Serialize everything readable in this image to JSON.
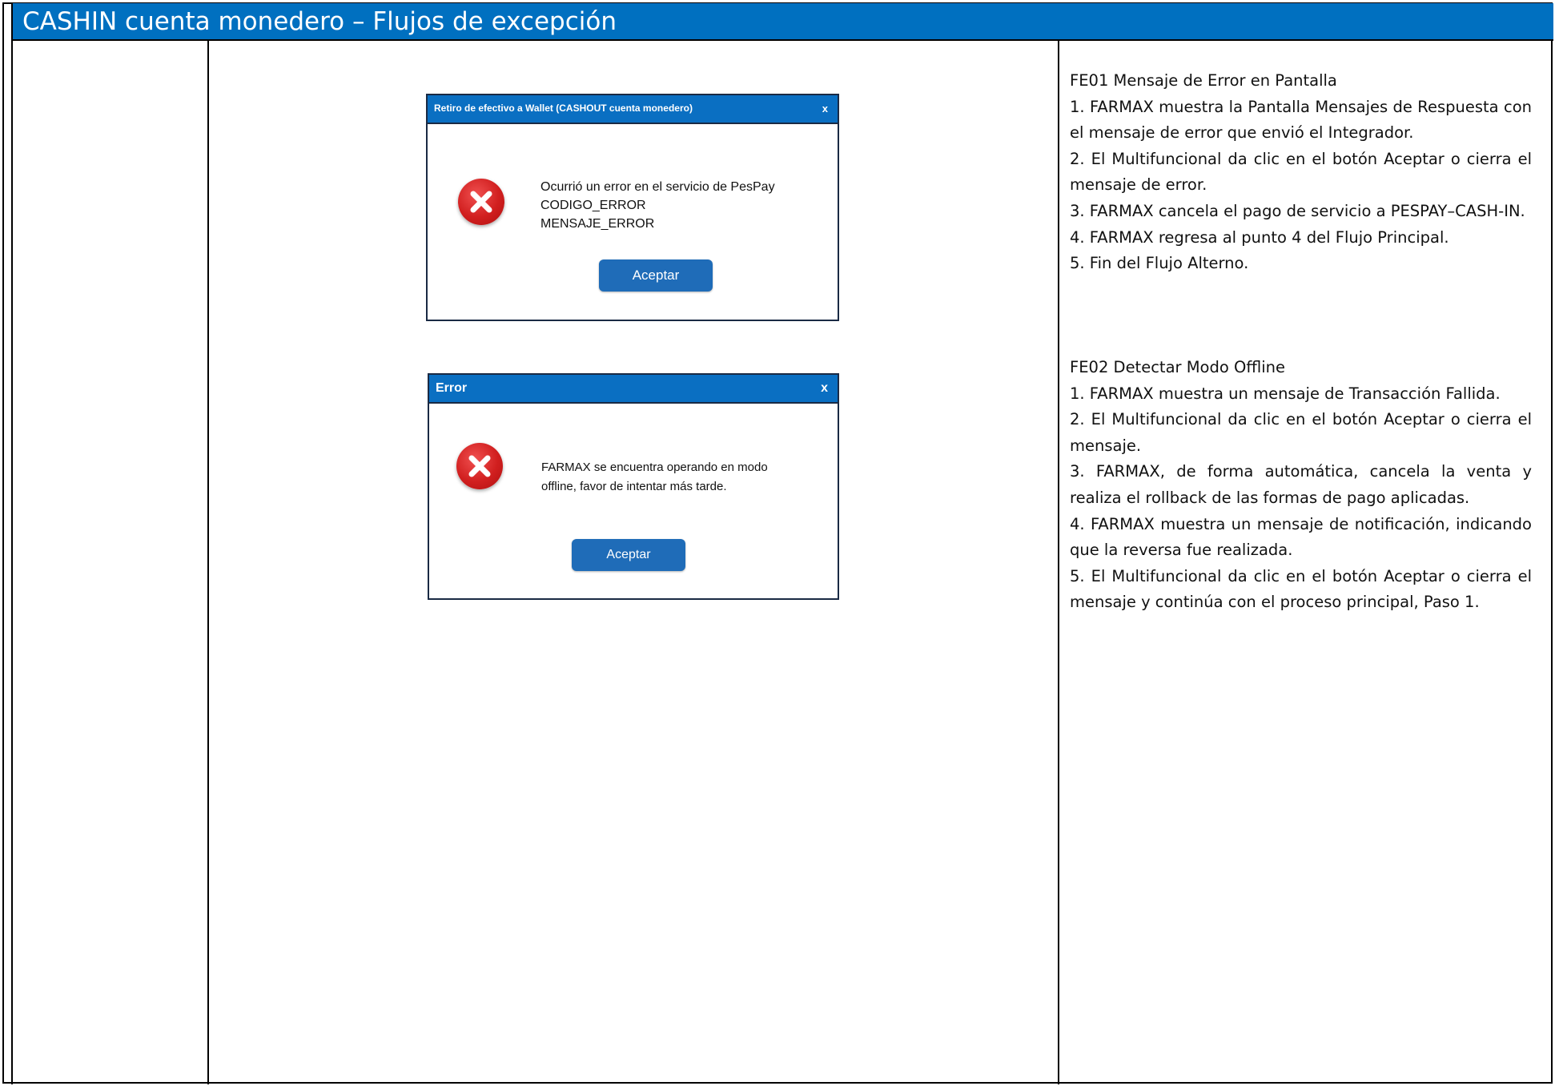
{
  "header": {
    "title": "CASHIN cuenta monedero – Flujos de excepción"
  },
  "dialogs": [
    {
      "title": "Retiro de efectivo a Wallet (CASHOUT cuenta monedero)",
      "close": "x",
      "message_lines": [
        "Ocurrió un error en el servicio de PesPay",
        "CODIGO_ERROR",
        "MENSAJE_ERROR"
      ],
      "button": "Aceptar",
      "icon": "error-x-icon",
      "titlebar_color": "#0a6fc2",
      "button_color": "#1f6cb8"
    },
    {
      "title": "Error",
      "close": "x",
      "message_lines": [
        "FARMAX se encuentra operando en modo",
        "offline, favor de intentar más tarde."
      ],
      "button": "Aceptar",
      "icon": "error-x-icon",
      "titlebar_color": "#0a6fc2",
      "button_color": "#1f6cb8"
    }
  ],
  "flows": [
    {
      "heading": "FE01 Mensaje de Error en Pantalla",
      "steps": [
        "1. FARMAX muestra la Pantalla Mensajes de Respuesta con el mensaje de error que envió el Integrador.",
        "2. El Multifuncional da clic en el botón Aceptar o cierra el mensaje de error.",
        "3. FARMAX cancela el pago de servicio a PESPAY–CASH-IN.",
        "4. FARMAX regresa al punto 4 del Flujo Principal.",
        "5. Fin del Flujo Alterno."
      ]
    },
    {
      "heading": "FE02 Detectar Modo Offline",
      "steps": [
        "1. FARMAX muestra un mensaje de Transacción Fallida.",
        "2. El Multifuncional da clic en el botón Aceptar o cierra el mensaje.",
        "3. FARMAX, de forma automática, cancela la venta y realiza el rollback de las formas de pago aplicadas.",
        "4. FARMAX muestra un mensaje de notificación, indicando que la reversa fue realizada.",
        "5. El Multifuncional da clic en el botón Aceptar o cierra el mensaje y continúa con el proceso principal, Paso 1."
      ]
    }
  ],
  "colors": {
    "header_bg": "#0070c0",
    "border": "#000000"
  }
}
